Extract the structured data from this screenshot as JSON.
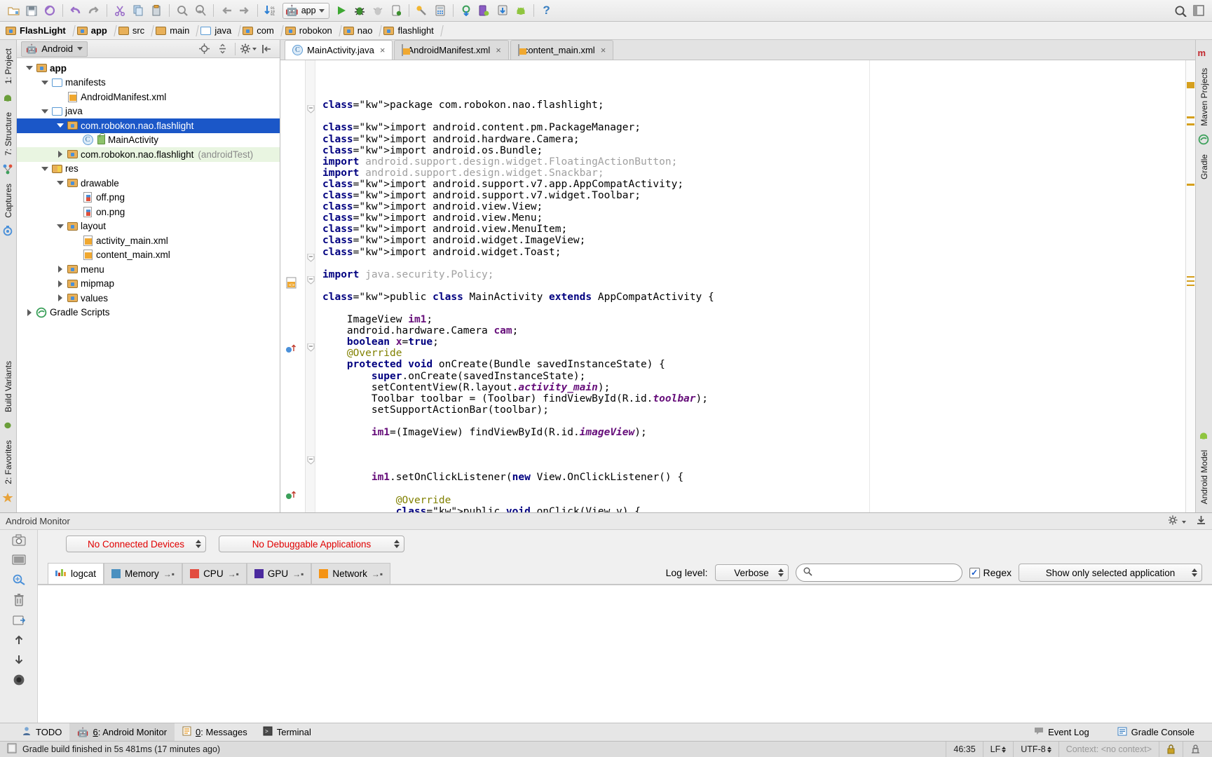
{
  "toolbar": {
    "icons": [
      "open-folder-icon",
      "save-all-icon",
      "sync-icon",
      "undo-icon",
      "redo-icon",
      "cut-icon",
      "copy-icon",
      "paste-icon",
      "find-icon",
      "replace-icon",
      "back-icon",
      "forward-icon",
      "compile-icon"
    ],
    "run_config_label": "app",
    "run_config_icon": "android-robot-icon",
    "right_icons": [
      "run-icon",
      "debug-icon",
      "debug-dim-icon",
      "device-debug-icon",
      "sdk-manager-icon",
      "avd-manager-icon",
      "sync-gradle-icon",
      "device-monitor-icon",
      "sdk-update-icon",
      "android-icon",
      "help-icon"
    ],
    "search_icon": "magnifier-icon",
    "layout_icon": "layout-icon"
  },
  "breadcrumb": {
    "items": [
      {
        "label": "FlashLight",
        "icon": "module-folder-icon",
        "bold": true
      },
      {
        "label": "app",
        "icon": "module-folder-icon",
        "bold": true
      },
      {
        "label": "src",
        "icon": "folder-icon",
        "bold": false
      },
      {
        "label": "main",
        "icon": "folder-icon",
        "bold": false
      },
      {
        "label": "java",
        "icon": "source-folder-icon",
        "bold": false
      },
      {
        "label": "com",
        "icon": "package-folder-icon",
        "bold": false
      },
      {
        "label": "robokon",
        "icon": "package-folder-icon",
        "bold": false
      },
      {
        "label": "nao",
        "icon": "package-folder-icon",
        "bold": false
      },
      {
        "label": "flashlight",
        "icon": "package-folder-icon",
        "bold": false
      }
    ]
  },
  "left_strip": {
    "items": [
      "1: Project",
      "7: Structure",
      "Captures"
    ],
    "icons": [
      "android-view-icon",
      "structure-icon",
      "captures-icon"
    ]
  },
  "left_strip_bottom": {
    "items": [
      "Build Variants",
      "2: Favorites"
    ]
  },
  "right_strip": {
    "items": [
      "Maven Projects",
      "Gradle"
    ]
  },
  "right_strip_bottom": {
    "items": [
      "Android Model"
    ]
  },
  "project_pane": {
    "title": "Android",
    "title_icon": "android-robot-icon",
    "header_icons": [
      "locate-icon",
      "collapse-all-icon",
      "settings-gear-icon",
      "hide-icon"
    ],
    "tree": [
      {
        "label": "app",
        "depth": 0,
        "twisty": "down",
        "icon": "module-folder-icon",
        "bold": true,
        "state": "normal"
      },
      {
        "label": "manifests",
        "depth": 1,
        "twisty": "down",
        "icon": "folder-blue-icon",
        "bold": false,
        "state": "normal"
      },
      {
        "label": "AndroidManifest.xml",
        "depth": 2,
        "twisty": "none",
        "icon": "xml-file-icon",
        "bold": false,
        "state": "normal"
      },
      {
        "label": "java",
        "depth": 1,
        "twisty": "down",
        "icon": "folder-blue-icon",
        "bold": false,
        "state": "normal"
      },
      {
        "label": "com.robokon.nao.flashlight",
        "depth": 2,
        "twisty": "down",
        "icon": "package-folder-icon",
        "bold": false,
        "state": "selected"
      },
      {
        "label": "MainActivity",
        "depth": 3,
        "twisty": "none",
        "icon": "java-class-icon",
        "bold": false,
        "state": "normal",
        "extra_icon": "lock-green-icon"
      },
      {
        "label": "com.robokon.nao.flashlight",
        "depth": 2,
        "twisty": "right",
        "icon": "package-folder-icon",
        "bold": false,
        "state": "test",
        "suffix": "(androidTest)"
      },
      {
        "label": "res",
        "depth": 1,
        "twisty": "down",
        "icon": "res-folder-icon",
        "bold": false,
        "state": "normal"
      },
      {
        "label": "drawable",
        "depth": 2,
        "twisty": "down",
        "icon": "package-folder-icon",
        "bold": false,
        "state": "normal"
      },
      {
        "label": "off.png",
        "depth": 3,
        "twisty": "none",
        "icon": "image-file-icon",
        "bold": false,
        "state": "normal"
      },
      {
        "label": "on.png",
        "depth": 3,
        "twisty": "none",
        "icon": "image-file-icon",
        "bold": false,
        "state": "normal"
      },
      {
        "label": "layout",
        "depth": 2,
        "twisty": "down",
        "icon": "package-folder-icon",
        "bold": false,
        "state": "normal"
      },
      {
        "label": "activity_main.xml",
        "depth": 3,
        "twisty": "none",
        "icon": "xml-file-icon",
        "bold": false,
        "state": "normal"
      },
      {
        "label": "content_main.xml",
        "depth": 3,
        "twisty": "none",
        "icon": "xml-file-icon",
        "bold": false,
        "state": "normal"
      },
      {
        "label": "menu",
        "depth": 2,
        "twisty": "right",
        "icon": "package-folder-icon",
        "bold": false,
        "state": "normal"
      },
      {
        "label": "mipmap",
        "depth": 2,
        "twisty": "right",
        "icon": "package-folder-icon",
        "bold": false,
        "state": "normal"
      },
      {
        "label": "values",
        "depth": 2,
        "twisty": "right",
        "icon": "package-folder-icon",
        "bold": false,
        "state": "normal"
      },
      {
        "label": "Gradle Scripts",
        "depth": 0,
        "twisty": "right",
        "icon": "gradle-icon",
        "bold": false,
        "state": "normal"
      }
    ]
  },
  "editor": {
    "tabs": [
      {
        "label": "MainActivity.java",
        "icon": "java-class-icon",
        "active": true,
        "close": "×"
      },
      {
        "label": "AndroidManifest.xml",
        "icon": "xml-file-icon",
        "active": false,
        "close": "×"
      },
      {
        "label": "content_main.xml",
        "icon": "xml-file-icon",
        "active": false,
        "close": "×"
      }
    ],
    "code_lines": [
      "package com.robokon.nao.flashlight;",
      "",
      "import android.content.pm.PackageManager;",
      "import android.hardware.Camera;",
      "import android.os.Bundle;",
      "import android.support.design.widget.FloatingActionButton;",
      "import android.support.design.widget.Snackbar;",
      "import android.support.v7.app.AppCompatActivity;",
      "import android.support.v7.widget.Toolbar;",
      "import android.view.View;",
      "import android.view.Menu;",
      "import android.view.MenuItem;",
      "import android.widget.ImageView;",
      "import android.widget.Toast;",
      "",
      "import java.security.Policy;",
      "",
      "public class MainActivity extends AppCompatActivity {",
      "",
      "    ImageView im1;",
      "    android.hardware.Camera cam;",
      "    boolean x=true;",
      "    @Override",
      "    protected void onCreate(Bundle savedInstanceState) {",
      "        super.onCreate(savedInstanceState);",
      "        setContentView(R.layout.activity_main);",
      "        Toolbar toolbar = (Toolbar) findViewById(R.id.toolbar);",
      "        setSupportActionBar(toolbar);",
      "",
      "        im1=(ImageView) findViewById(R.id.imageView);",
      "",
      "",
      "",
      "        im1.setOnClickListener(new View.OnClickListener() {",
      "",
      "            @Override",
      "            public void onClick(View v) {"
    ]
  },
  "monitor": {
    "title": "Android Monitor",
    "header_icons": [
      "settings-gear-icon",
      "minimize-icon"
    ],
    "device_combo": "No Connected Devices",
    "process_combo": "No Debuggable Applications",
    "side_icons": [
      "screenshot-icon",
      "screen-record-icon",
      "layout-inspector-icon",
      "trash-icon",
      "export-icon",
      "scroll-up-icon",
      "scroll-down-icon",
      "record-icon"
    ],
    "tabs": [
      {
        "label": "logcat",
        "icon": "logcat-icon",
        "color": "#8fc53f",
        "active": true,
        "detach": false
      },
      {
        "label": "Memory",
        "icon": "memory-icon",
        "color": "#4a90c0",
        "active": false,
        "detach": true
      },
      {
        "label": "CPU",
        "icon": "cpu-icon",
        "color": "#e24c40",
        "active": false,
        "detach": true
      },
      {
        "label": "GPU",
        "icon": "gpu-icon",
        "color": "#4b2a9e",
        "active": false,
        "detach": true
      },
      {
        "label": "Network",
        "icon": "network-icon",
        "color": "#f59415",
        "active": false,
        "detach": true
      }
    ],
    "log_level_label": "Log level:",
    "log_level_value": "Verbose",
    "search_placeholder": "",
    "search_value": "",
    "search_icon": "magnifier-icon",
    "regex_label": "Regex",
    "regex_checked": true,
    "filter_combo": "Show only selected application"
  },
  "bottom_tabs": {
    "items": [
      {
        "label": "TODO",
        "icon": "todo-icon",
        "mnemonic": "",
        "active": false
      },
      {
        "label": ": Android Monitor",
        "icon": "android-robot-icon",
        "mnemonic": "6",
        "active": true
      },
      {
        "label": ": Messages",
        "icon": "messages-icon",
        "mnemonic": "0",
        "active": false
      },
      {
        "label": "Terminal",
        "icon": "terminal-icon",
        "mnemonic": "",
        "active": false
      }
    ],
    "right": [
      {
        "label": "Event Log",
        "icon": "event-log-icon"
      },
      {
        "label": "Gradle Console",
        "icon": "gradle-console-icon"
      }
    ]
  },
  "status_bar": {
    "icon": "build-status-icon",
    "message": "Gradle build finished in 5s 481ms (17 minutes ago)",
    "caret": "46:35",
    "line_sep": "LF",
    "encoding": "UTF-8",
    "context": "Context: <no context>",
    "right_icons": [
      "lock-icon",
      "inspection-icon"
    ]
  },
  "colors": {
    "selection_blue": "#1b57c8",
    "error_red": "#e00000",
    "keyword_navy": "#000080",
    "field_purple": "#660e7a",
    "annotation_olive": "#808000",
    "test_scope_green": "#e9f5e1",
    "android_green": "#8fc53f"
  }
}
